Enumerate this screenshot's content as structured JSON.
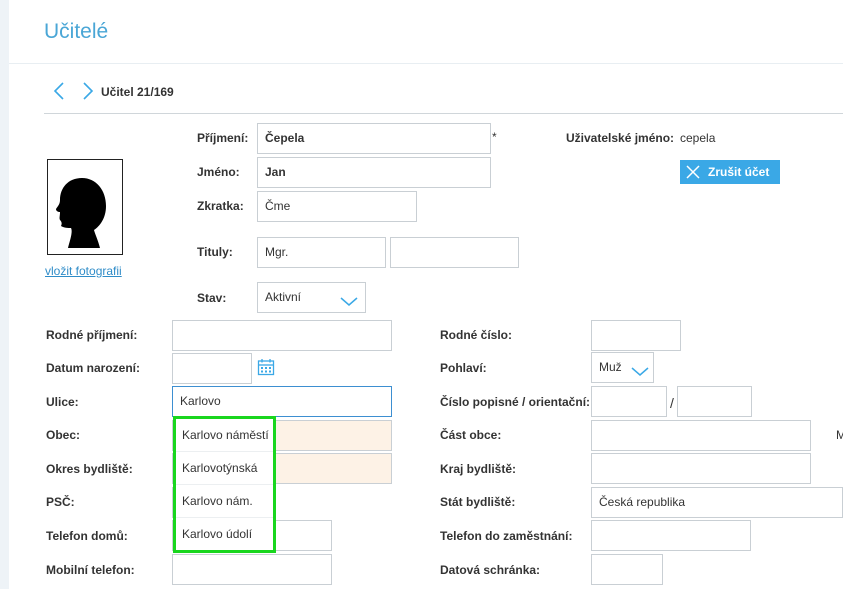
{
  "page": {
    "title": "Učitelé"
  },
  "nav": {
    "record_counter": "Učitel 21/169"
  },
  "photo": {
    "link_text": "vložit fotografii"
  },
  "account": {
    "username_label": "Uživatelské jméno:",
    "username_value": "cepela",
    "cancel_button": "Zrušit účet",
    "button_color": "#3aa8e6"
  },
  "form": {
    "prijmeni": {
      "label": "Příjmení:",
      "value": "Čepela",
      "required_mark": "*"
    },
    "jmeno": {
      "label": "Jméno:",
      "value": "Jan"
    },
    "zkratka": {
      "label": "Zkratka:",
      "value": "Čme"
    },
    "tituly": {
      "label": "Tituly:",
      "before": "Mgr.",
      "after": ""
    },
    "stav": {
      "label": "Stav:",
      "value": "Aktivní"
    },
    "rodne_prijmeni": {
      "label": "Rodné příjmení:",
      "value": ""
    },
    "datum_narozeni": {
      "label": "Datum narození:",
      "value": ""
    },
    "ulice": {
      "label": "Ulice:",
      "value": "Karlovo"
    },
    "obec": {
      "label": "Obec:",
      "value": ""
    },
    "okres": {
      "label": "Okres bydliště:",
      "value": ""
    },
    "psc": {
      "label": "PSČ:",
      "value": ""
    },
    "telefon_domu": {
      "label": "Telefon domů:",
      "value": ""
    },
    "mobilni_telefon": {
      "label": "Mobilní telefon:",
      "value": ""
    },
    "rodne_cislo": {
      "label": "Rodné číslo:",
      "value": ""
    },
    "pohlavi": {
      "label": "Pohlaví:",
      "value": "Muž"
    },
    "cislo_popisne": {
      "label": "Číslo popisné / orientační:",
      "separator": "/",
      "popisne": "",
      "orientacni": ""
    },
    "cast_obce": {
      "label": "Část obce:",
      "value": ""
    },
    "kraj": {
      "label": "Kraj bydliště:",
      "value": ""
    },
    "stat": {
      "label": "Stát bydliště:",
      "value": "Česká republika"
    },
    "telefon_zamestnani": {
      "label": "Telefon do zaměstnání:",
      "value": ""
    },
    "datova_schranka": {
      "label": "Datová schránka:",
      "value": ""
    },
    "edge_cut_label": "M"
  },
  "autocomplete": {
    "highlight_color": "#19d61e",
    "items": [
      "Karlovo náměstí",
      "Karlovotýnská",
      "Karlovo nám.",
      "Karlovo údolí"
    ]
  },
  "icons": {
    "prev": "chevron-left-icon",
    "next": "chevron-right-icon",
    "cancel": "close-icon",
    "calendar": "calendar-icon",
    "select": "chevron-down-icon",
    "photo": "silhouette-icon"
  }
}
